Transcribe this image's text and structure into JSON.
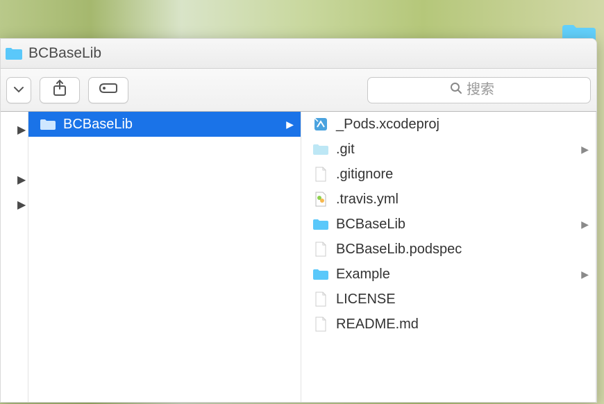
{
  "window": {
    "title": "BCBaseLib"
  },
  "toolbar": {
    "search_placeholder": "搜索"
  },
  "column1": {
    "items": [
      {
        "name": "BCBaseLib",
        "type": "folder",
        "selected": true,
        "has_arrow": true
      }
    ]
  },
  "column2": {
    "items": [
      {
        "name": "_Pods.xcodeproj",
        "type": "xcodeproj",
        "has_arrow": false
      },
      {
        "name": ".git",
        "type": "folder-light",
        "has_arrow": true
      },
      {
        "name": ".gitignore",
        "type": "file",
        "has_arrow": false
      },
      {
        "name": ".travis.yml",
        "type": "yml",
        "has_arrow": false
      },
      {
        "name": "BCBaseLib",
        "type": "folder",
        "has_arrow": true
      },
      {
        "name": "BCBaseLib.podspec",
        "type": "file",
        "has_arrow": false
      },
      {
        "name": "Example",
        "type": "folder",
        "has_arrow": true
      },
      {
        "name": "LICENSE",
        "type": "file",
        "has_arrow": false
      },
      {
        "name": "README.md",
        "type": "file",
        "has_arrow": false
      }
    ]
  },
  "colors": {
    "selection": "#1a73e8",
    "folder": "#5ac8fa",
    "folder_light": "#bde7f5"
  }
}
